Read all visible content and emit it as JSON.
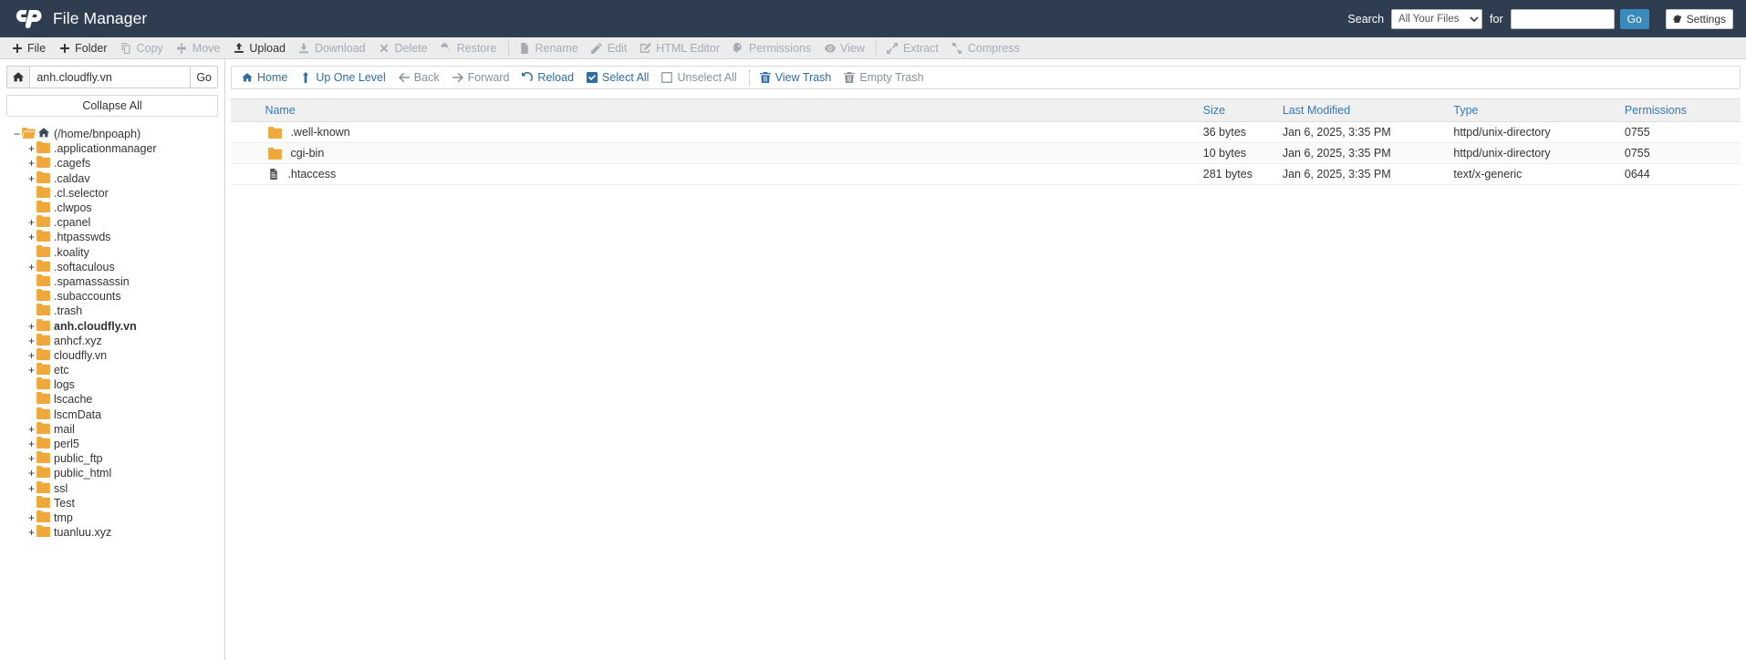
{
  "header": {
    "app_title": "File Manager",
    "logo_icon": "cpanel-logo",
    "search_label": "Search",
    "search_scope_selected": "All Your Files",
    "search_scope_options": [
      "All Your Files"
    ],
    "for_label": "for",
    "search_value": "",
    "search_placeholder": "",
    "go_label": "Go",
    "settings_label": "Settings",
    "settings_icon": "gear-icon",
    "accent_color": "#3a8bbb",
    "bar_color": "#2e3e50"
  },
  "toolbar": {
    "items": [
      {
        "label": "File",
        "icon": "plus-icon",
        "disabled": false
      },
      {
        "label": "Folder",
        "icon": "plus-icon",
        "disabled": false
      },
      {
        "label": "Copy",
        "icon": "copy-icon",
        "disabled": true
      },
      {
        "label": "Move",
        "icon": "move-icon",
        "disabled": true
      },
      {
        "label": "Upload",
        "icon": "upload-icon",
        "disabled": false
      },
      {
        "label": "Download",
        "icon": "download-icon",
        "disabled": true
      },
      {
        "label": "Delete",
        "icon": "delete-x-icon",
        "disabled": true
      },
      {
        "label": "Restore",
        "icon": "restore-undo-icon",
        "disabled": true
      },
      {
        "label": "Rename",
        "icon": "file-icon",
        "disabled": true,
        "separator_before": true
      },
      {
        "label": "Edit",
        "icon": "pencil-icon",
        "disabled": true
      },
      {
        "label": "HTML Editor",
        "icon": "html-editor-icon",
        "disabled": true
      },
      {
        "label": "Permissions",
        "icon": "key-icon",
        "disabled": true
      },
      {
        "label": "View",
        "icon": "eye-icon",
        "disabled": true
      },
      {
        "label": "Extract",
        "icon": "extract-icon",
        "disabled": true,
        "separator_before": true
      },
      {
        "label": "Compress",
        "icon": "compress-icon",
        "disabled": true
      }
    ]
  },
  "sidebar": {
    "home_icon": "home-icon",
    "path_value": "anh.cloudfly.vn",
    "path_placeholder": "",
    "go_label": "Go",
    "collapse_all_label": "Collapse All",
    "tree": [
      {
        "label": "(/home/bnpoaph)",
        "toggle": "minus",
        "indent": 0,
        "icon": "open-folder-home-icon",
        "bold": false
      },
      {
        "label": ".applicationmanager",
        "toggle": "plus",
        "indent": 1,
        "icon": "folder-icon",
        "bold": false
      },
      {
        "label": ".cagefs",
        "toggle": "plus",
        "indent": 1,
        "icon": "folder-icon",
        "bold": false
      },
      {
        "label": ".caldav",
        "toggle": "plus",
        "indent": 1,
        "icon": "folder-icon",
        "bold": false
      },
      {
        "label": ".cl.selector",
        "toggle": "none",
        "indent": 1,
        "icon": "folder-icon",
        "bold": false
      },
      {
        "label": ".clwpos",
        "toggle": "none",
        "indent": 1,
        "icon": "folder-icon",
        "bold": false
      },
      {
        "label": ".cpanel",
        "toggle": "plus",
        "indent": 1,
        "icon": "folder-icon",
        "bold": false
      },
      {
        "label": ".htpasswds",
        "toggle": "plus",
        "indent": 1,
        "icon": "folder-icon",
        "bold": false
      },
      {
        "label": ".koality",
        "toggle": "none",
        "indent": 1,
        "icon": "folder-icon",
        "bold": false
      },
      {
        "label": ".softaculous",
        "toggle": "plus",
        "indent": 1,
        "icon": "folder-icon",
        "bold": false
      },
      {
        "label": ".spamassassin",
        "toggle": "none",
        "indent": 1,
        "icon": "folder-icon",
        "bold": false
      },
      {
        "label": ".subaccounts",
        "toggle": "none",
        "indent": 1,
        "icon": "folder-icon",
        "bold": false
      },
      {
        "label": ".trash",
        "toggle": "none",
        "indent": 1,
        "icon": "folder-icon",
        "bold": false
      },
      {
        "label": "anh.cloudfly.vn",
        "toggle": "plus",
        "indent": 1,
        "icon": "folder-icon",
        "bold": true
      },
      {
        "label": "anhcf.xyz",
        "toggle": "plus",
        "indent": 1,
        "icon": "folder-icon",
        "bold": false
      },
      {
        "label": "cloudfly.vn",
        "toggle": "plus",
        "indent": 1,
        "icon": "folder-icon",
        "bold": false
      },
      {
        "label": "etc",
        "toggle": "plus",
        "indent": 1,
        "icon": "folder-icon",
        "bold": false
      },
      {
        "label": "logs",
        "toggle": "none",
        "indent": 1,
        "icon": "folder-icon",
        "bold": false
      },
      {
        "label": "lscache",
        "toggle": "none",
        "indent": 1,
        "icon": "folder-icon",
        "bold": false
      },
      {
        "label": "lscmData",
        "toggle": "none",
        "indent": 1,
        "icon": "folder-icon",
        "bold": false
      },
      {
        "label": "mail",
        "toggle": "plus",
        "indent": 1,
        "icon": "folder-icon",
        "bold": false
      },
      {
        "label": "perl5",
        "toggle": "plus",
        "indent": 1,
        "icon": "folder-icon",
        "bold": false
      },
      {
        "label": "public_ftp",
        "toggle": "plus",
        "indent": 1,
        "icon": "folder-icon",
        "bold": false
      },
      {
        "label": "public_html",
        "toggle": "plus",
        "indent": 1,
        "icon": "folder-icon",
        "bold": false
      },
      {
        "label": "ssl",
        "toggle": "plus",
        "indent": 1,
        "icon": "folder-icon",
        "bold": false
      },
      {
        "label": "Test",
        "toggle": "none",
        "indent": 1,
        "icon": "folder-icon",
        "bold": false
      },
      {
        "label": "tmp",
        "toggle": "plus",
        "indent": 1,
        "icon": "folder-icon",
        "bold": false
      },
      {
        "label": "tuanluu.xyz",
        "toggle": "plus",
        "indent": 1,
        "icon": "folder-icon",
        "bold": false
      }
    ]
  },
  "navbar": {
    "items": [
      {
        "label": "Home",
        "icon": "home-icon",
        "muted": false
      },
      {
        "label": "Up One Level",
        "icon": "arrow-up-icon",
        "muted": false
      },
      {
        "label": "Back",
        "icon": "arrow-left-icon",
        "muted": true
      },
      {
        "label": "Forward",
        "icon": "arrow-right-icon",
        "muted": true
      },
      {
        "label": "Reload",
        "icon": "reload-icon",
        "muted": false
      },
      {
        "label": "Select All",
        "icon": "checkbox-checked-icon",
        "muted": false
      },
      {
        "label": "Unselect All",
        "icon": "checkbox-empty-icon",
        "muted": true
      },
      {
        "label": "View Trash",
        "icon": "trash-icon",
        "muted": false,
        "separator_before": true
      },
      {
        "label": "Empty Trash",
        "icon": "trash-icon",
        "muted": true
      }
    ]
  },
  "file_table": {
    "columns": [
      "Name",
      "Size",
      "Last Modified",
      "Type",
      "Permissions"
    ],
    "rows": [
      {
        "icon": "folder-icon",
        "name": ".well-known",
        "size": "36 bytes",
        "modified": "Jan 6, 2025, 3:35 PM",
        "type": "httpd/unix-directory",
        "permissions": "0755"
      },
      {
        "icon": "folder-icon",
        "name": "cgi-bin",
        "size": "10 bytes",
        "modified": "Jan 6, 2025, 3:35 PM",
        "type": "httpd/unix-directory",
        "permissions": "0755"
      },
      {
        "icon": "file-text-icon",
        "name": ".htaccess",
        "size": "281 bytes",
        "modified": "Jan 6, 2025, 3:35 PM",
        "type": "text/x-generic",
        "permissions": "0644"
      }
    ]
  }
}
